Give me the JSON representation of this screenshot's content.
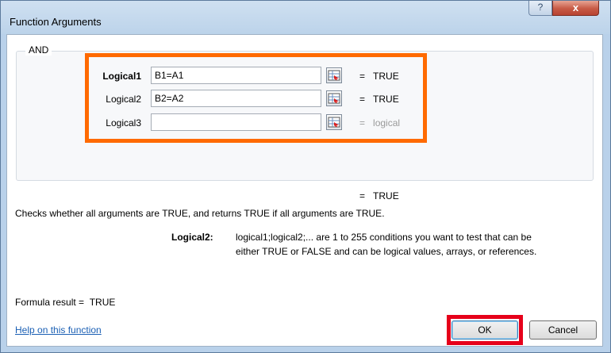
{
  "window": {
    "title": "Function Arguments"
  },
  "titlebar_buttons": {
    "help": "?",
    "close": "x"
  },
  "function_name": "AND",
  "arguments": [
    {
      "label": "Logical1",
      "value": "B1=A1",
      "result": "TRUE",
      "bold": true
    },
    {
      "label": "Logical2",
      "value": "B2=A2",
      "result": "TRUE",
      "bold": false
    },
    {
      "label": "Logical3",
      "value": "",
      "result": "logical",
      "bold": false
    }
  ],
  "equals_sign": "=",
  "overall_result": "TRUE",
  "description": "Checks whether all arguments are TRUE, and returns TRUE if all arguments are TRUE.",
  "arg_help": {
    "label": "Logical2:",
    "line1": "logical1;logical2;... are 1 to 255 conditions you want to test that can be",
    "line2": "either TRUE or FALSE and can be logical values, arrays, or references."
  },
  "formula_result": {
    "label": "Formula result =",
    "value": "TRUE"
  },
  "help_link": "Help on this function",
  "buttons": {
    "ok": "OK",
    "cancel": "Cancel"
  },
  "colors": {
    "highlight_orange": "#ff6a00",
    "highlight_red": "#e6001a",
    "link": "#1a5fb4"
  }
}
